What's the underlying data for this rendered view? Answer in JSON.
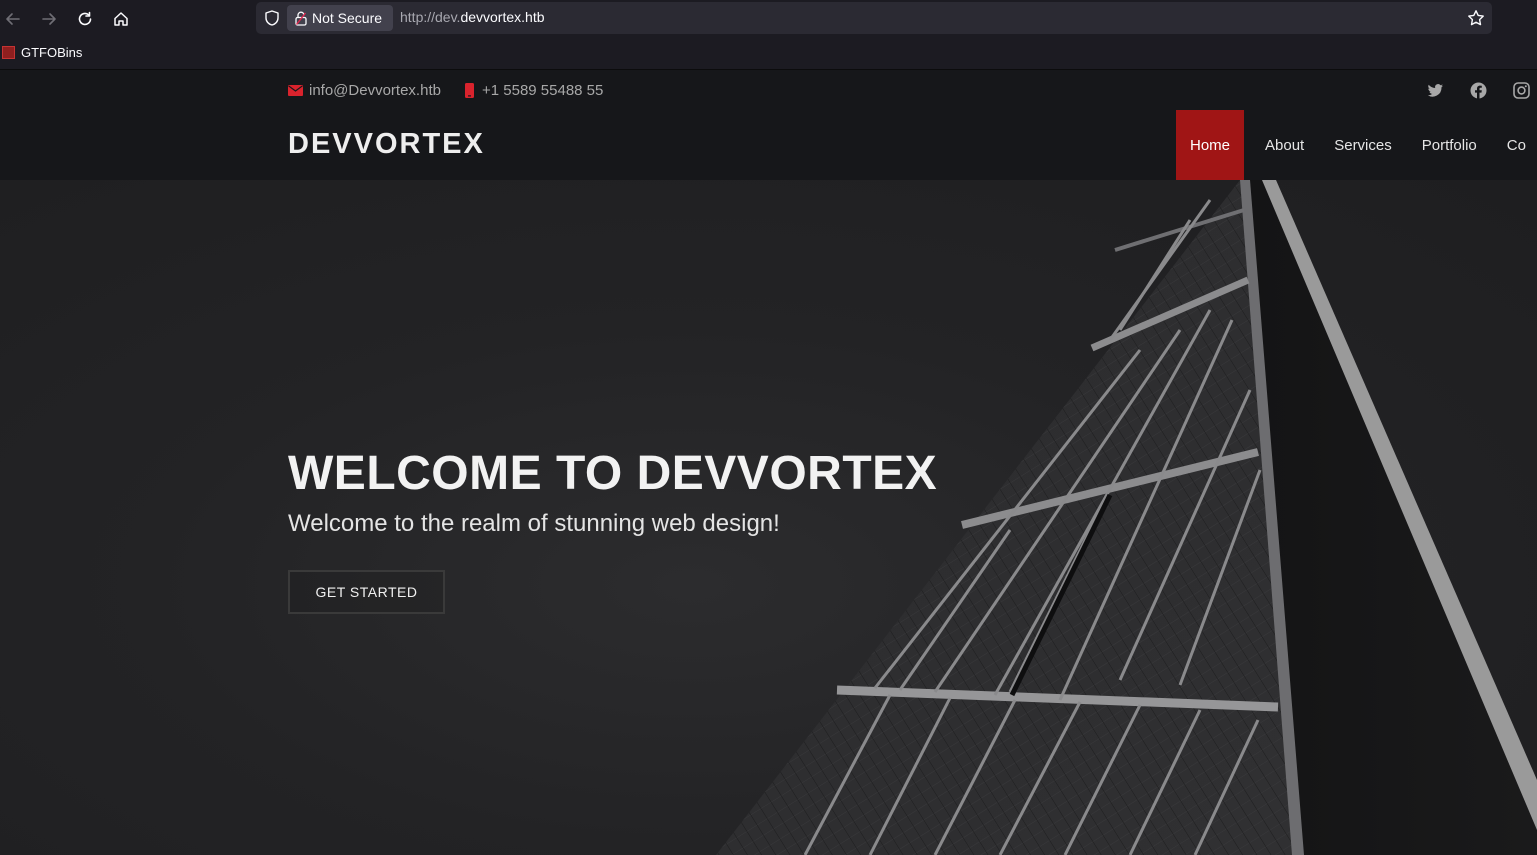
{
  "browser": {
    "security_label": "Not Secure",
    "url_prefix": "http://dev.",
    "url_host": "devvortex.htb",
    "bookmarks": [
      {
        "label": "GTFOBins"
      }
    ]
  },
  "site": {
    "email": "info@Devvortex.htb",
    "phone": "+1 5589 55488 55",
    "logo": "DEVVORTEX",
    "social_icons": [
      "twitter-icon",
      "facebook-icon",
      "instagram-icon"
    ],
    "menu": [
      {
        "label": "Home",
        "active": true
      },
      {
        "label": "About"
      },
      {
        "label": "Services"
      },
      {
        "label": "Portfolio"
      },
      {
        "label": "Co"
      }
    ],
    "accent_color": "#a01515"
  },
  "hero": {
    "title": "WELCOME TO DEVVORTEX",
    "subtitle": "Welcome to the realm of stunning web design!",
    "cta": "GET STARTED"
  }
}
